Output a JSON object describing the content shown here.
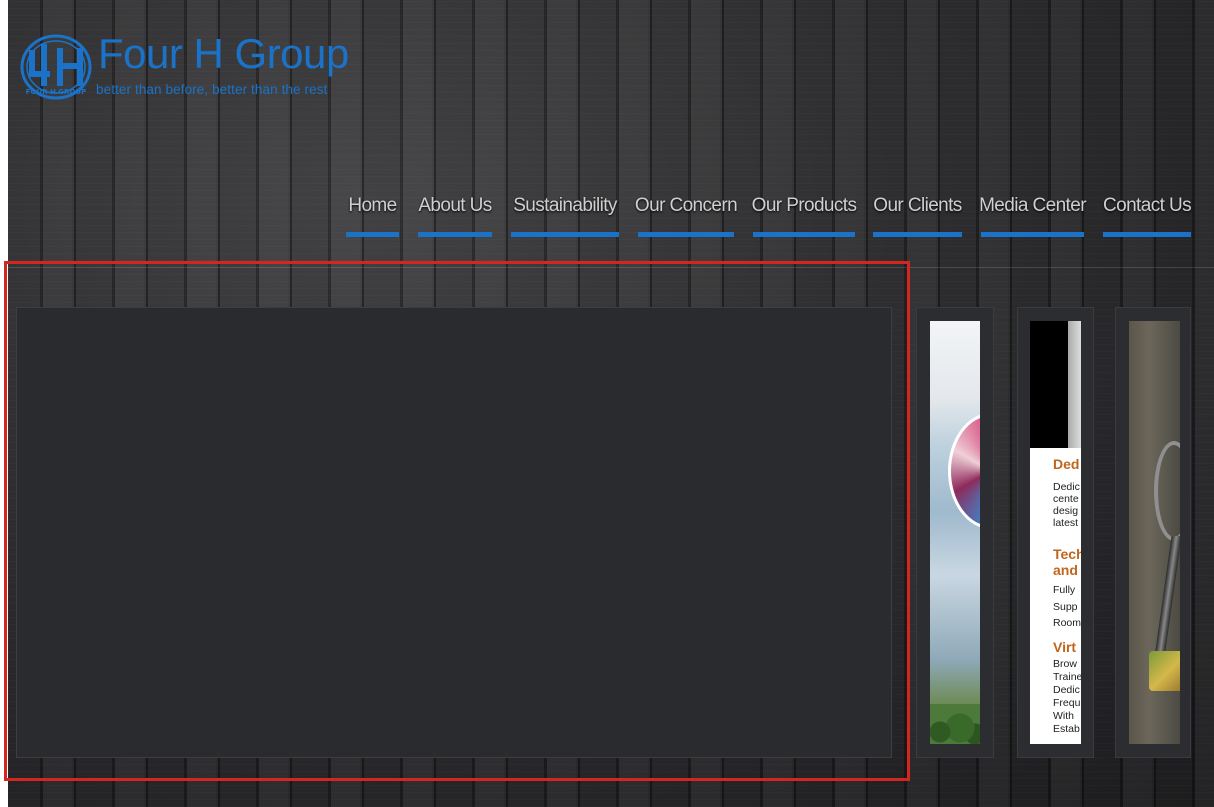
{
  "brand": {
    "name": "Four H Group",
    "tagline": "better than before, better than the rest",
    "mark_text": "FOUR H GROUP",
    "color": "#1a73c8"
  },
  "nav": {
    "items": [
      {
        "label": "Home"
      },
      {
        "label": "About Us"
      },
      {
        "label": "Sustainability"
      },
      {
        "label": "Our Concern"
      },
      {
        "label": "Our Products"
      },
      {
        "label": "Our Clients"
      },
      {
        "label": "Media Center"
      },
      {
        "label": "Contact Us"
      }
    ],
    "accent": "#1a73c8"
  },
  "slider": {
    "highlight_color": "#d3261f",
    "thumbnails": [
      {
        "name": "textile-globe"
      },
      {
        "name": "brochure",
        "lines": [
          {
            "text": "Ded",
            "style": "h"
          },
          {
            "text": "Dedic",
            "style": "b"
          },
          {
            "text": "cente",
            "style": "b"
          },
          {
            "text": "desig",
            "style": "b"
          },
          {
            "text": "latest",
            "style": "b"
          },
          {
            "text": "Tech",
            "style": "h"
          },
          {
            "text": "and",
            "style": "h"
          },
          {
            "text": "Fully",
            "style": "b"
          },
          {
            "text": "Supp",
            "style": "b"
          },
          {
            "text": "Room",
            "style": "b"
          },
          {
            "text": "Virt",
            "style": "h"
          },
          {
            "text": "Brow",
            "style": "b"
          },
          {
            "text": "Traine",
            "style": "b"
          },
          {
            "text": "Dedic",
            "style": "b"
          },
          {
            "text": "Frequ",
            "style": "b"
          },
          {
            "text": "With",
            "style": "b"
          },
          {
            "text": "Estab",
            "style": "b"
          }
        ]
      },
      {
        "name": "trophy-award"
      }
    ]
  }
}
